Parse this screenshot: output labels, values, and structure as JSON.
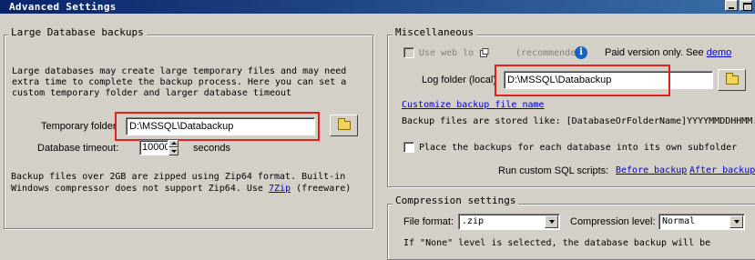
{
  "window": {
    "title": "Advanced Settings"
  },
  "large_db": {
    "legend": "Large Database backups",
    "description_line1": "Large databases may create large temporary files and may need",
    "description_line2": "extra time to complete the backup process. Here you can set a",
    "description_line3": "custom temporary folder and larger database timeout",
    "temp_folder_label": "Temporary folder",
    "temp_folder_value": "D:\\MSSQL\\Databackup",
    "timeout_label": "Database timeout:",
    "timeout_value": "10000",
    "timeout_unit": "seconds",
    "zip_note_line1": "Backup files over 2GB are zipped using Zip64 format. Built-in",
    "zip_note_line2_prefix": "Windows compressor does not support Zip64. Use ",
    "zip_note_link": "7Zip",
    "zip_note_suffix": " (freeware)"
  },
  "misc": {
    "legend": "Miscellaneous",
    "use_weblog_label": "Use web lo",
    "recommended_label": "(recommende",
    "paid_text": "Paid version only. See ",
    "demo_link": "demo",
    "log_folder_label": "Log folder (local)",
    "log_folder_value": "D:\\MSSQL\\Databackup",
    "customize_link": "Customize backup file name",
    "stored_like_text": "Backup files are stored like: [DatabaseOrFolderName]YYYYMMDDHHMM.",
    "subfolder_label": "Place the backups for each database into its own subfolder",
    "custom_sql_label": "Run custom SQL scripts:",
    "before_backup_link": "Before backup",
    "after_backup_link": "After backup"
  },
  "compression": {
    "legend": "Compression settings",
    "file_format_label": "File format:",
    "file_format_value": ".zip",
    "level_label": "Compression level:",
    "level_value": "Normal",
    "none_note": "If \"None\" level is selected, the database backup will be"
  },
  "colors": {
    "titlebar": "#0a246a",
    "highlight": "#e0201a",
    "link": "#0000cc",
    "face": "#d4d0c8"
  },
  "icons": {
    "folder": "folder-icon",
    "info": "info-icon",
    "weblog": "weblog-icon"
  }
}
